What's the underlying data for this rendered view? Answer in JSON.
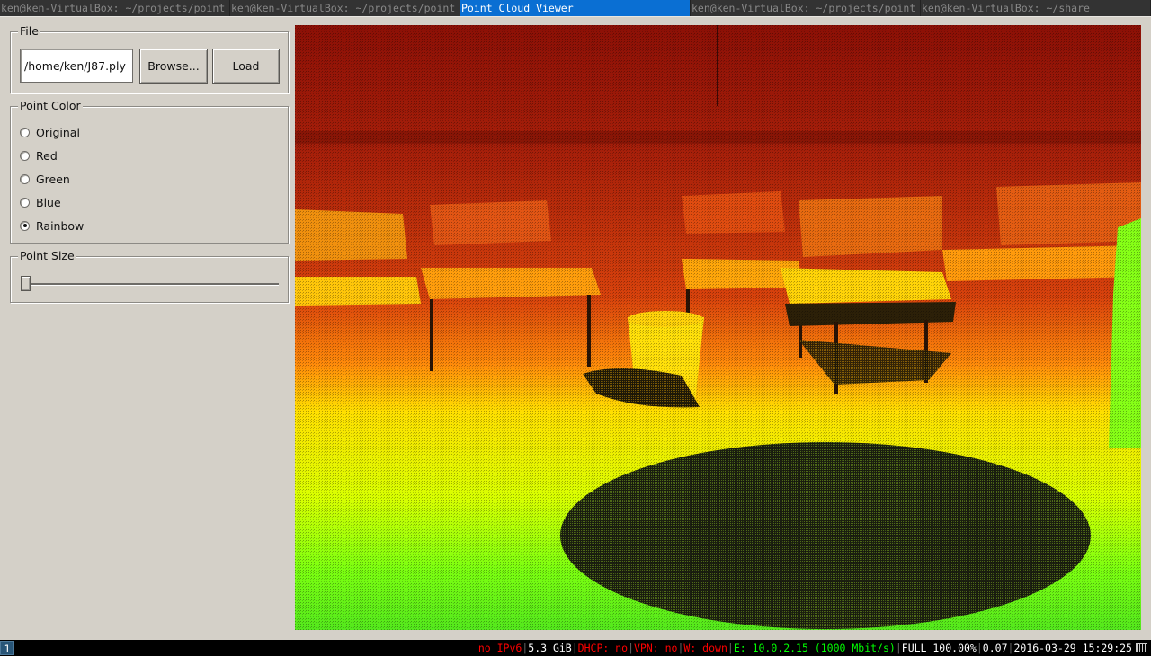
{
  "tabs": [
    {
      "title": "ken@ken-VirtualBox: ~/projects/point",
      "state": "inactive"
    },
    {
      "title": "ken@ken-VirtualBox: ~/projects/point",
      "state": "inactive"
    },
    {
      "title": "Point Cloud Viewer",
      "state": "focused"
    },
    {
      "title": "ken@ken-VirtualBox: ~/projects/point",
      "state": "inactive"
    },
    {
      "title": "ken@ken-VirtualBox: ~/share",
      "state": "inactive"
    }
  ],
  "file": {
    "title": "File",
    "path_value": "/home/ken/J87.ply",
    "browse_label": "Browse...",
    "load_label": "Load"
  },
  "point_color": {
    "title": "Point Color",
    "options": [
      "Original",
      "Red",
      "Green",
      "Blue",
      "Rainbow"
    ],
    "selected": "Rainbow"
  },
  "point_size": {
    "title": "Point Size",
    "value_fraction": 0.0
  },
  "statusbar": {
    "workspace": "1",
    "items": [
      {
        "text": "no IPv6",
        "color": "#ff0000"
      },
      {
        "text": "5.3 GiB",
        "color": "#ffffff"
      },
      {
        "text": "DHCP: no",
        "color": "#ff0000"
      },
      {
        "text": "VPN: no",
        "color": "#ff0000"
      },
      {
        "text": "W: down",
        "color": "#ff0000"
      },
      {
        "text": "E: 10.0.2.15 (1000 Mbit/s)",
        "color": "#00ff00"
      },
      {
        "text": "FULL 100.00%",
        "color": "#ffffff"
      },
      {
        "text": "0.07",
        "color": "#ffffff"
      },
      {
        "text": "2016-03-29 15:29:25",
        "color": "#ffffff"
      }
    ]
  },
  "colors": {
    "focused_tab": "#0a6fd3",
    "inactive_tab": "#333333",
    "panel_bg": "#d4d0c8"
  }
}
